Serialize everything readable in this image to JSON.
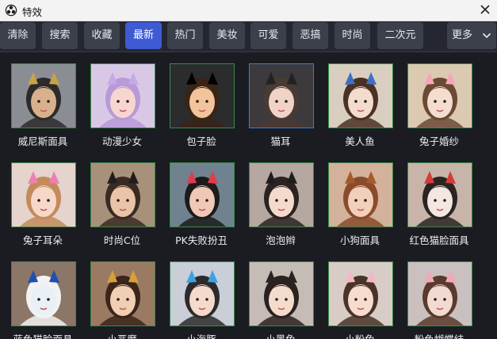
{
  "window": {
    "title": "特效"
  },
  "toolbar": {
    "buttons": [
      "清除",
      "搜索",
      "收藏",
      "最新",
      "热门",
      "美妆",
      "可爱",
      "恶搞",
      "时尚",
      "二次元"
    ],
    "active_index": 3,
    "more_label": "更多"
  },
  "effects": [
    {
      "label": "威尼斯面具",
      "icon": "venetian-mask-thumbnail",
      "bg": "#8b8d94",
      "skin": "#d9b08c",
      "hair": "#2b2b2b",
      "prop": "#c9a24a"
    },
    {
      "label": "动漫少女",
      "icon": "anime-girl-thumbnail",
      "bg": "#d8c8e6",
      "skin": "#f6d6cf",
      "hair": "#b89ad8",
      "prop": "#c8a8e8"
    },
    {
      "label": "包子脸",
      "icon": "bun-face-thumbnail",
      "bg": "#2a2c2e",
      "skin": "#f1c49b",
      "hair": "#3a2416",
      "prop": "#000000"
    },
    {
      "label": "猫耳",
      "icon": "cat-ear-thumbnail",
      "bg": "#3c3a3c",
      "skin": "#f0d3c6",
      "hair": "#4a3a34",
      "prop": "#222222"
    },
    {
      "label": "美人鱼",
      "icon": "mermaid-thumbnail",
      "bg": "#d8cfc0",
      "skin": "#f3dccd",
      "hair": "#4b3124",
      "prop": "#3f6fc2"
    },
    {
      "label": "兔子婚纱",
      "icon": "bunny-wedding-thumbnail",
      "bg": "#dcc9b2",
      "skin": "#f4dccf",
      "hair": "#6b4a34",
      "prop": "#f4a8b6"
    },
    {
      "label": "兔子耳朵",
      "icon": "bunny-ears-thumbnail",
      "bg": "#e4d4cc",
      "skin": "#f5d8c9",
      "hair": "#c48a5c",
      "prop": "#ef7fb2"
    },
    {
      "label": "时尚C位",
      "icon": "fashion-center-thumbnail",
      "bg": "#a8917b",
      "skin": "#e9c4a8",
      "hair": "#3a2a22",
      "prop": "#1e1e1e"
    },
    {
      "label": "PK失败扮丑",
      "icon": "ugly-face-thumbnail",
      "bg": "#70828f",
      "skin": "#f0c8b8",
      "hair": "#1b1b1b",
      "prop": "#e23b4a"
    },
    {
      "label": "泡泡辫",
      "icon": "bubble-braid-thumbnail",
      "bg": "#b6a7a0",
      "skin": "#f4dacd",
      "hair": "#2b2321",
      "prop": "#1e1e1e"
    },
    {
      "label": "小狗面具",
      "icon": "puppy-mask-thumbnail",
      "bg": "#d4b19a",
      "skin": "#f2cfb8",
      "hair": "#8a4b2c",
      "prop": "#a35a2c"
    },
    {
      "label": "红色猫脸面具",
      "icon": "red-cat-mask-thumbnail",
      "bg": "#c8b4a8",
      "skin": "#f4e6e0",
      "hair": "#2a2422",
      "prop": "#d73a3a"
    },
    {
      "label": "蓝色猫脸面具",
      "icon": "blue-cat-mask-thumbnail",
      "bg": "#8b7667",
      "skin": "#e9f0f6",
      "hair": "#f2f2f2",
      "prop": "#1f4fb0"
    },
    {
      "label": "小恶魔",
      "icon": "little-devil-thumbnail",
      "bg": "#9b7a64",
      "skin": "#f0cfb5",
      "hair": "#3b2419",
      "prop": "#d6a03a"
    },
    {
      "label": "小海豚",
      "icon": "dolphin-thumbnail",
      "bg": "#c9ced7",
      "skin": "#f3dacb",
      "hair": "#2c2a2c",
      "prop": "#3fa2e0"
    },
    {
      "label": "小黑兔",
      "icon": "black-bunny-thumbnail",
      "bg": "#c6bcb6",
      "skin": "#f4dccc",
      "hair": "#2a2220",
      "prop": "#2a2220"
    },
    {
      "label": "小粉兔",
      "icon": "pink-bunny-thumbnail",
      "bg": "#d7cdc6",
      "skin": "#f5dccf",
      "hair": "#4a3328",
      "prop": "#f2b8c8"
    },
    {
      "label": "粉色蝴蝶结",
      "icon": "pink-bow-thumbnail",
      "bg": "#c9c0bf",
      "skin": "#f3dad0",
      "hair": "#5a3a2c",
      "prop": "#f0a8b8"
    }
  ],
  "selected_index": 3
}
